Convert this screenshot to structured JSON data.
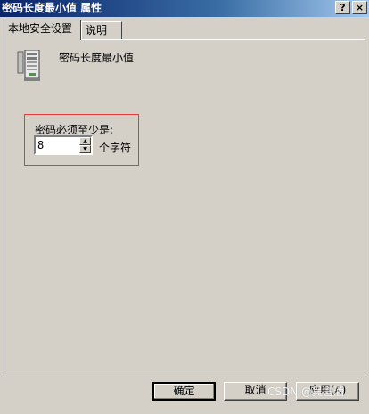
{
  "window": {
    "title": "密码长度最小值 属性",
    "help_button": "?",
    "close_button": "×"
  },
  "tabs": [
    {
      "label": "本地安全设置",
      "active": true
    },
    {
      "label": "说明",
      "active": false
    }
  ],
  "policy": {
    "icon": "server-computer-icon",
    "name": "密码长度最小值"
  },
  "setting": {
    "label": "密码必须至少是:",
    "value": "8",
    "unit": "个字符"
  },
  "buttons": {
    "ok": "确定",
    "cancel": "取消",
    "apply": "应用(A)"
  },
  "watermark": "CSDN @吴言酒",
  "colors": {
    "face": "#d4d0c8",
    "highlight_box": "#e83a3a",
    "title_active": "#0a246a"
  }
}
